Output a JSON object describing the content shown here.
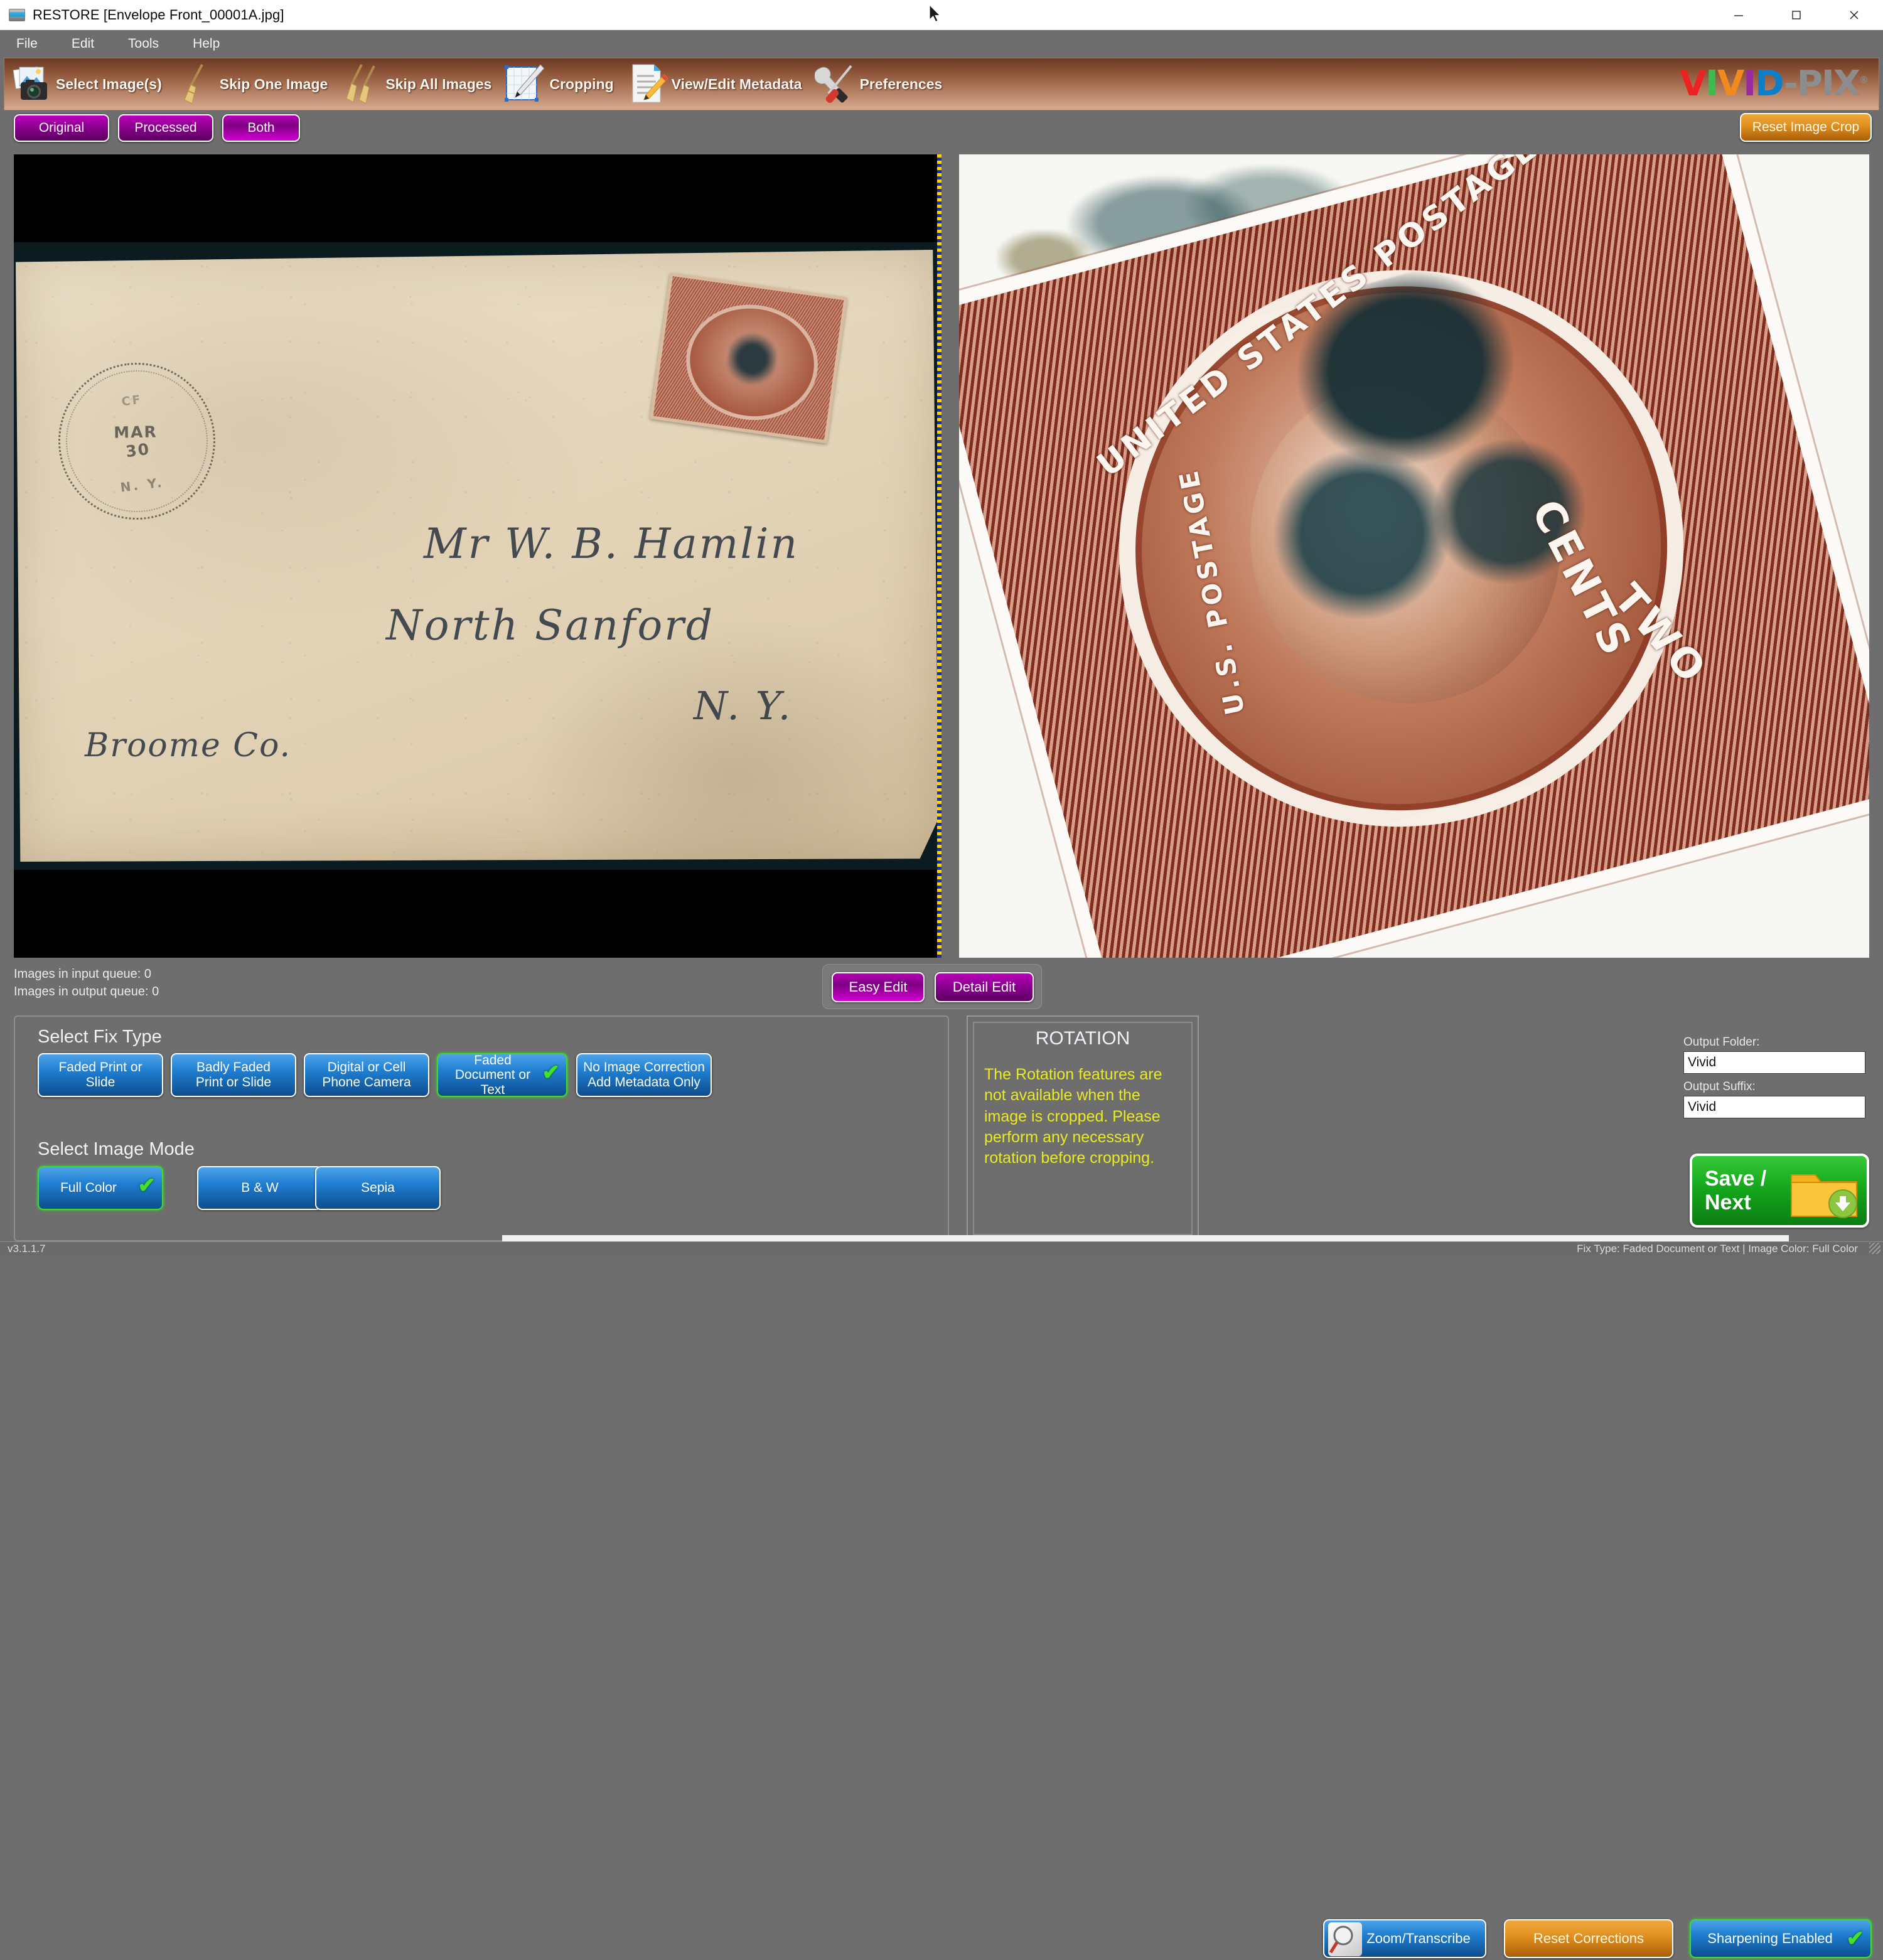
{
  "window": {
    "app_name": "RESTORE",
    "file_in_title": "[Envelope Front_00001A.jpg]",
    "title_full": "RESTORE  [Envelope Front_00001A.jpg]",
    "minimize": "—",
    "maximize": "☐",
    "close": "✕"
  },
  "menu": {
    "items": [
      "File",
      "Edit",
      "Tools",
      "Help"
    ]
  },
  "toolbar": {
    "items": [
      {
        "label": "Select Image(s)",
        "icon": "photos-camera-icon"
      },
      {
        "label": "Skip One Image",
        "icon": "broom-icon"
      },
      {
        "label": "Skip All Images",
        "icon": "double-broom-icon"
      },
      {
        "label": "Cropping",
        "icon": "crop-pen-icon"
      },
      {
        "label": "View/Edit Metadata",
        "icon": "document-pencil-icon"
      },
      {
        "label": "Preferences",
        "icon": "wrench-screwdriver-icon"
      }
    ],
    "logo": {
      "letters": [
        {
          "ch": "V",
          "color": "#ee2222"
        },
        {
          "ch": "I",
          "color": "#3fba4f"
        },
        {
          "ch": "V",
          "color": "#f08a1c"
        },
        {
          "ch": "I",
          "color": "#9a2aa0"
        },
        {
          "ch": "D",
          "color": "#0d7ec8"
        },
        {
          "ch": "-",
          "color": "#8d8d8d"
        },
        {
          "ch": "P",
          "color": "#8d8d8d"
        },
        {
          "ch": "I",
          "color": "#8d8d8d"
        },
        {
          "ch": "X",
          "color": "#8d8d8d"
        }
      ],
      "registered": "®"
    }
  },
  "view_modes": {
    "options": [
      "Original",
      "Processed",
      "Both"
    ],
    "selected": "Both"
  },
  "reset_crop_button": {
    "label": "Reset Image Crop"
  },
  "image_panes": {
    "original": {
      "handwriting": [
        "Mr W. B. Hamlin",
        "North Sanford",
        "N. Y.",
        "Broome Co."
      ],
      "postmark": {
        "top": "CF",
        "month": "MAR",
        "day": "30",
        "state": "N. Y."
      },
      "stamp_text": "U.S. POSTAGE TWO CENTS"
    },
    "processed": {
      "stamp_words": [
        "UNITED STATES POSTAGE",
        "CENTS",
        "TWO",
        "U.S. POSTAGE"
      ]
    }
  },
  "queue": {
    "input_line": "Images in input queue:  0",
    "output_line": "Images in output queue: 0"
  },
  "edit_mode": {
    "options": [
      "Easy Edit",
      "Detail Edit"
    ],
    "selected": "Easy Edit"
  },
  "right_tools": {
    "zoom_transcribe": "Zoom/Transcribe",
    "reset_corrections": "Reset Corrections",
    "sharpening": "Sharpening Enabled",
    "sharpening_enabled": true,
    "check_glyph": "✔"
  },
  "fix_type": {
    "title": "Select Fix Type",
    "options": [
      "Faded Print or Slide",
      "Badly Faded\nPrint or Slide",
      "Digital or Cell\nPhone Camera",
      "Faded Document or\nText",
      "No Image Correction\nAdd Metadata Only"
    ],
    "selected": "Faded Document or Text"
  },
  "image_mode": {
    "title": "Select Image Mode",
    "options": [
      "Full Color",
      "B & W",
      "Sepia"
    ],
    "selected": "Full Color"
  },
  "rotation": {
    "title": "ROTATION",
    "message": "The Rotation features are not available when the image is cropped. Please perform any necessary rotation before cropping."
  },
  "output": {
    "folder_label": "Output Folder:",
    "folder_value": "Vivid",
    "suffix_label": "Output Suffix:",
    "suffix_value": "Vivid"
  },
  "save_next": {
    "label_line1": "Save /",
    "label_line2": "Next",
    "icon": "folder-download-icon"
  },
  "status_bar": {
    "version": "v3.1.1.7",
    "fix_status": "Fix Type:  Faded Document or Text | Image Color: Full Color"
  },
  "colors": {
    "window_bg": "#6e6e6e",
    "toolbar_gradient_start": "#6b3a24",
    "toolbar_gradient_end": "#d9ab90",
    "accent_blue": "#1f7ed0",
    "accent_magenta": "#b600b6",
    "accent_orange": "#e08e1e",
    "accent_green": "#16a81c",
    "selected_outline": "#3ddb2a",
    "warning_text": "#e9ea22"
  }
}
